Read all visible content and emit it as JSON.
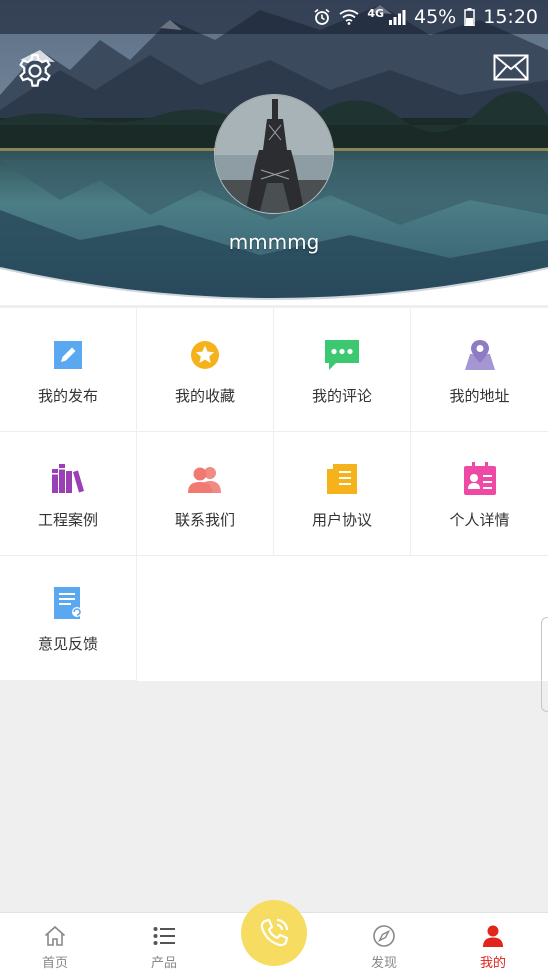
{
  "statusbar": {
    "network": "4G",
    "battery": "45%",
    "time": "15:20",
    "icons": [
      "alarm-icon",
      "wifi-icon",
      "signal-icon",
      "battery-icon"
    ]
  },
  "header": {
    "username": "mmmmg",
    "settings_icon": "gear-icon",
    "message_icon": "envelope-icon"
  },
  "menu": [
    {
      "label": "我的发布",
      "icon": "pencil-icon",
      "color": "#5aa9f0"
    },
    {
      "label": "我的收藏",
      "icon": "star-icon",
      "color": "#f5b21b"
    },
    {
      "label": "我的评论",
      "icon": "comment-icon",
      "color": "#3cc870"
    },
    {
      "label": "我的地址",
      "icon": "map-pin-icon",
      "color": "#8e7bc4"
    },
    {
      "label": "工程案例",
      "icon": "books-icon",
      "color": "#9b3fb5"
    },
    {
      "label": "联系我们",
      "icon": "contacts-icon",
      "color": "#f07a72"
    },
    {
      "label": "用户协议",
      "icon": "agreement-icon",
      "color": "#f5b21b"
    },
    {
      "label": "个人详情",
      "icon": "id-card-icon",
      "color": "#ee4aa5"
    },
    {
      "label": "意见反馈",
      "icon": "feedback-icon",
      "color": "#5aa9f0"
    }
  ],
  "tabbar": {
    "tabs": [
      {
        "label": "首页",
        "icon": "home-icon"
      },
      {
        "label": "产品",
        "icon": "list-icon"
      },
      {
        "label": "发现",
        "icon": "compass-icon"
      },
      {
        "label": "我的",
        "icon": "person-icon",
        "active": true
      }
    ],
    "call_icon": "phone-icon",
    "accent": "#e0251b",
    "call_color": "#f7dc62"
  }
}
